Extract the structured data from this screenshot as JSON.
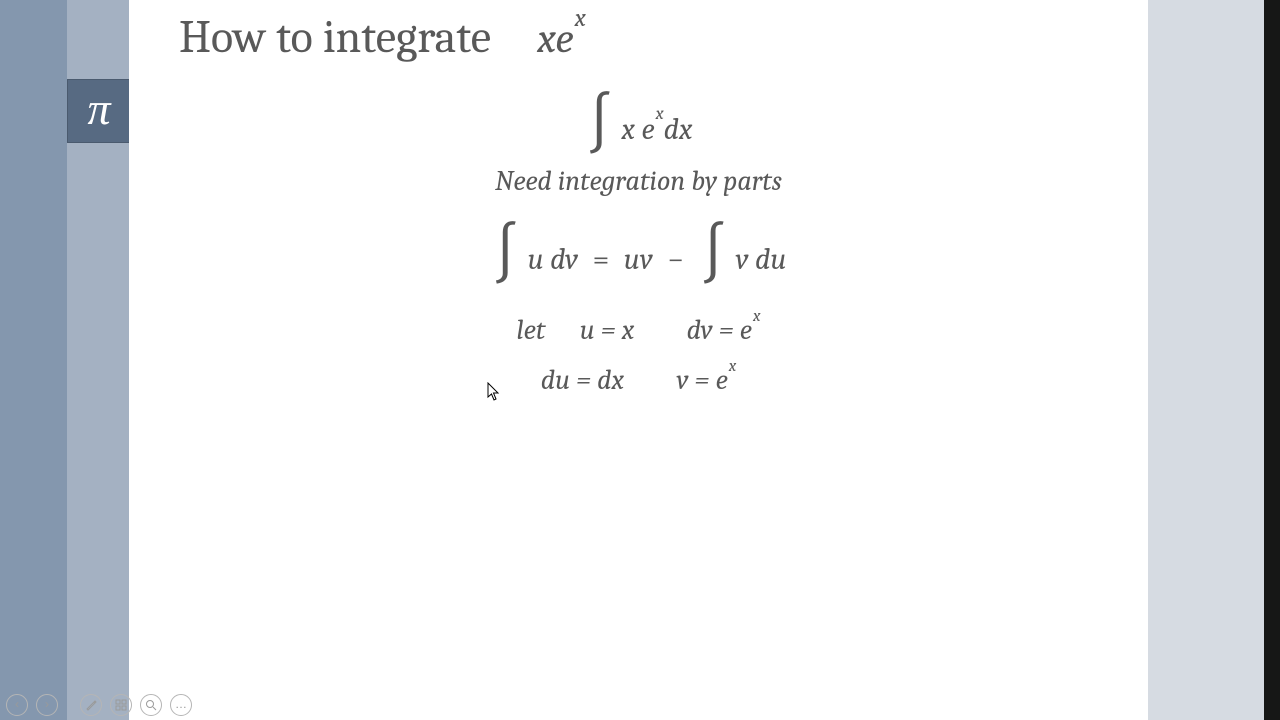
{
  "title": {
    "text": "How to integrate",
    "expr_base": "xe",
    "expr_sup": "x"
  },
  "pi": "π",
  "lines": {
    "l1": {
      "pre": "x e",
      "sup": "x",
      "post": "dx"
    },
    "l2": "Need integration by parts",
    "l3": {
      "a": "u dv",
      "eq1": "=",
      "b": "uv",
      "minus": "−",
      "c": "v du"
    },
    "l4": {
      "lead": "let",
      "ueq": "u = x",
      "dveq": "dv = e",
      "dvsup": "x"
    },
    "l5": {
      "dueq": "du = dx",
      "veq": "v = e",
      "vsup": "x"
    }
  },
  "toolbar": {
    "prev": "‹",
    "next": "›",
    "pen": "pen",
    "copy": "copy",
    "zoom": "zoom",
    "more": "…"
  }
}
